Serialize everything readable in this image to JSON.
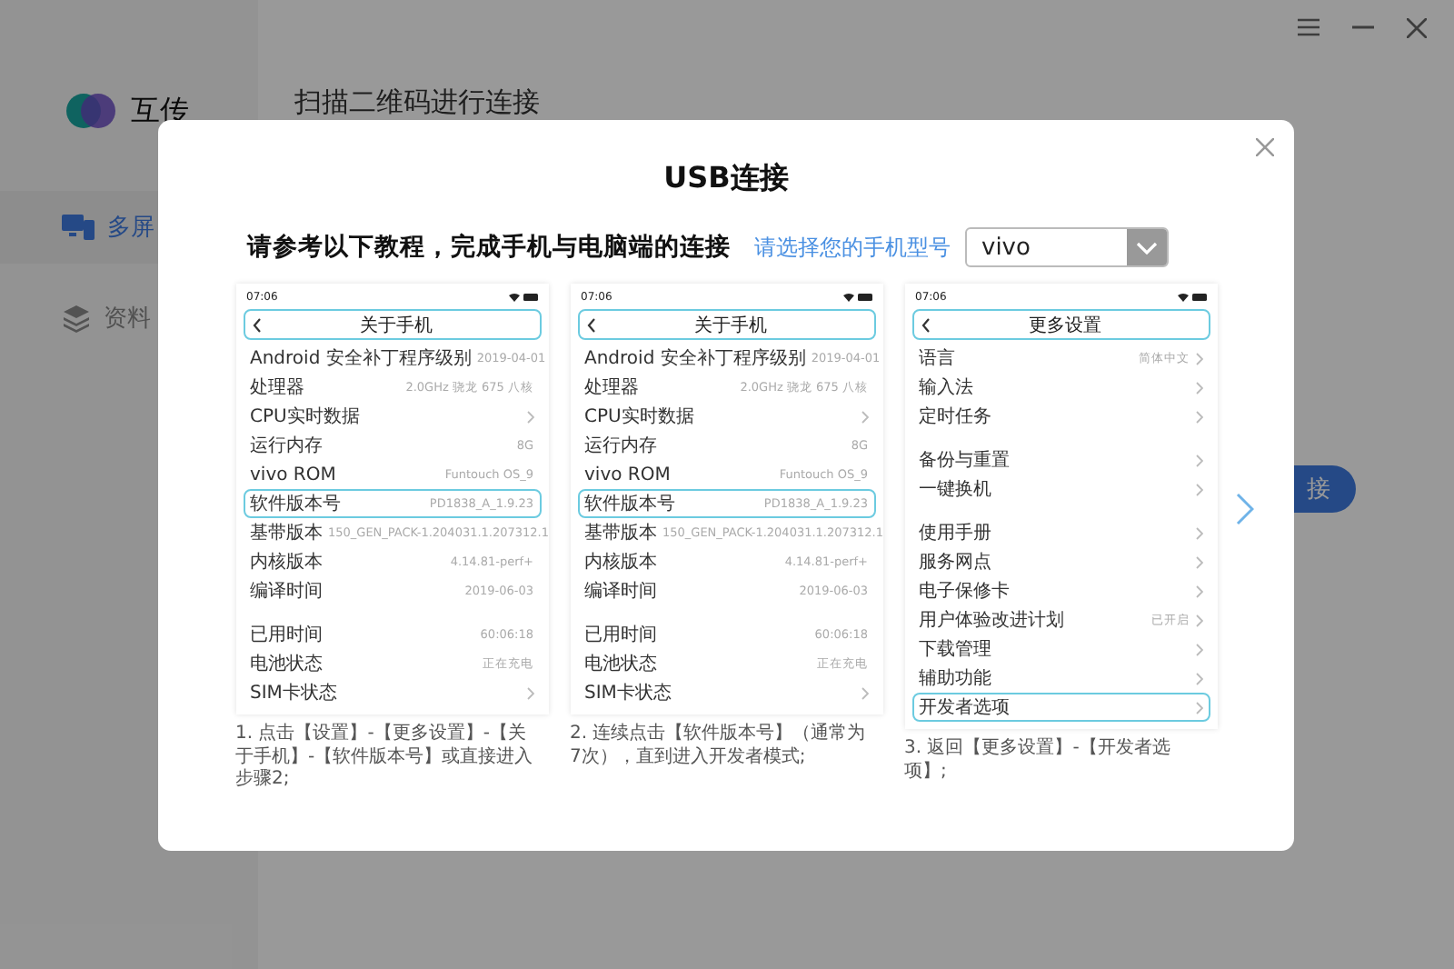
{
  "app": {
    "name": "互传",
    "heading": "扫描二维码进行连接",
    "sidebar": [
      {
        "label": "多屏",
        "kind": "devices",
        "selected": true
      },
      {
        "label": "资料",
        "kind": "layers",
        "selected": false
      }
    ],
    "connect_button": "接"
  },
  "dialog": {
    "title": "USB连接",
    "instruction": "请参考以下教程，完成手机与电脑端的连接",
    "model_link": "请选择您的手机型号",
    "model_select": {
      "value": "vivo"
    },
    "steps": [
      {
        "phone": {
          "time": "07:06",
          "title": "关于手机",
          "groups": [
            [
              {
                "label": "Android 安全补丁程序级别",
                "value": "2019-04-01",
                "chevron": false,
                "highlighted": false
              },
              {
                "label": "处理器",
                "value": "2.0GHz 骁龙 675 八核",
                "chevron": false,
                "highlighted": false
              },
              {
                "label": "CPU实时数据",
                "chevron": true,
                "highlighted": false
              },
              {
                "label": "运行内存",
                "value": "8G",
                "chevron": false,
                "highlighted": false
              },
              {
                "label": "vivo ROM",
                "value": "Funtouch OS_9",
                "chevron": false,
                "highlighted": false
              },
              {
                "label": "软件版本号",
                "value": "PD1838_A_1.9.23",
                "chevron": false,
                "highlighted": true
              },
              {
                "label": "基带版本",
                "value": "150_GEN_PACK-1.204031.1.207312.1",
                "chevron": false,
                "highlighted": false
              },
              {
                "label": "内核版本",
                "value": "4.14.81-perf+",
                "chevron": false,
                "highlighted": false
              },
              {
                "label": "编译时间",
                "value": "2019-06-03",
                "chevron": false,
                "highlighted": false
              }
            ],
            [
              {
                "label": "已用时间",
                "value": "60:06:18",
                "chevron": false,
                "highlighted": false
              },
              {
                "label": "电池状态",
                "value": "正在充电",
                "chevron": false,
                "highlighted": false
              },
              {
                "label": "SIM卡状态",
                "chevron": true,
                "highlighted": false
              }
            ]
          ]
        },
        "caption": "1. 点击【设置】-【更多设置】-【关于手机】-【软件版本号】或直接进入步骤2;"
      },
      {
        "phone": {
          "time": "07:06",
          "title": "关于手机",
          "groups": [
            [
              {
                "label": "Android 安全补丁程序级别",
                "value": "2019-04-01",
                "chevron": false,
                "highlighted": false
              },
              {
                "label": "处理器",
                "value": "2.0GHz 骁龙 675 八核",
                "chevron": false,
                "highlighted": false
              },
              {
                "label": "CPU实时数据",
                "chevron": true,
                "highlighted": false
              },
              {
                "label": "运行内存",
                "value": "8G",
                "chevron": false,
                "highlighted": false
              },
              {
                "label": "vivo ROM",
                "value": "Funtouch OS_9",
                "chevron": false,
                "highlighted": false
              },
              {
                "label": "软件版本号",
                "value": "PD1838_A_1.9.23",
                "chevron": false,
                "highlighted": true
              },
              {
                "label": "基带版本",
                "value": "150_GEN_PACK-1.204031.1.207312.1",
                "chevron": false,
                "highlighted": false
              },
              {
                "label": "内核版本",
                "value": "4.14.81-perf+",
                "chevron": false,
                "highlighted": false
              },
              {
                "label": "编译时间",
                "value": "2019-06-03",
                "chevron": false,
                "highlighted": false
              }
            ],
            [
              {
                "label": "已用时间",
                "value": "60:06:18",
                "chevron": false,
                "highlighted": false
              },
              {
                "label": "电池状态",
                "value": "正在充电",
                "chevron": false,
                "highlighted": false
              },
              {
                "label": "SIM卡状态",
                "chevron": true,
                "highlighted": false
              }
            ]
          ]
        },
        "caption": "2. 连续点击【软件版本号】（通常为7次），直到进入开发者模式;"
      },
      {
        "phone": {
          "time": "07:06",
          "title": "更多设置",
          "groups": [
            [
              {
                "label": "语言",
                "value": "简体中文",
                "chevron": true,
                "highlighted": false
              },
              {
                "label": "输入法",
                "chevron": true,
                "highlighted": false
              },
              {
                "label": "定时任务",
                "chevron": true,
                "highlighted": false
              }
            ],
            [
              {
                "label": "备份与重置",
                "chevron": true,
                "highlighted": false
              },
              {
                "label": "一键换机",
                "chevron": true,
                "highlighted": false
              }
            ],
            [
              {
                "label": "使用手册",
                "chevron": true,
                "highlighted": false
              },
              {
                "label": "服务网点",
                "chevron": true,
                "highlighted": false
              },
              {
                "label": "电子保修卡",
                "chevron": true,
                "highlighted": false
              },
              {
                "label": "用户体验改进计划",
                "value": "已开启",
                "chevron": true,
                "highlighted": false
              },
              {
                "label": "下载管理",
                "chevron": true,
                "highlighted": false
              },
              {
                "label": "辅助功能",
                "chevron": true,
                "highlighted": false
              },
              {
                "label": "开发者选项",
                "chevron": true,
                "highlighted": true
              }
            ]
          ]
        },
        "caption": "3. 返回【更多设置】-【开发者选项】;"
      }
    ]
  }
}
